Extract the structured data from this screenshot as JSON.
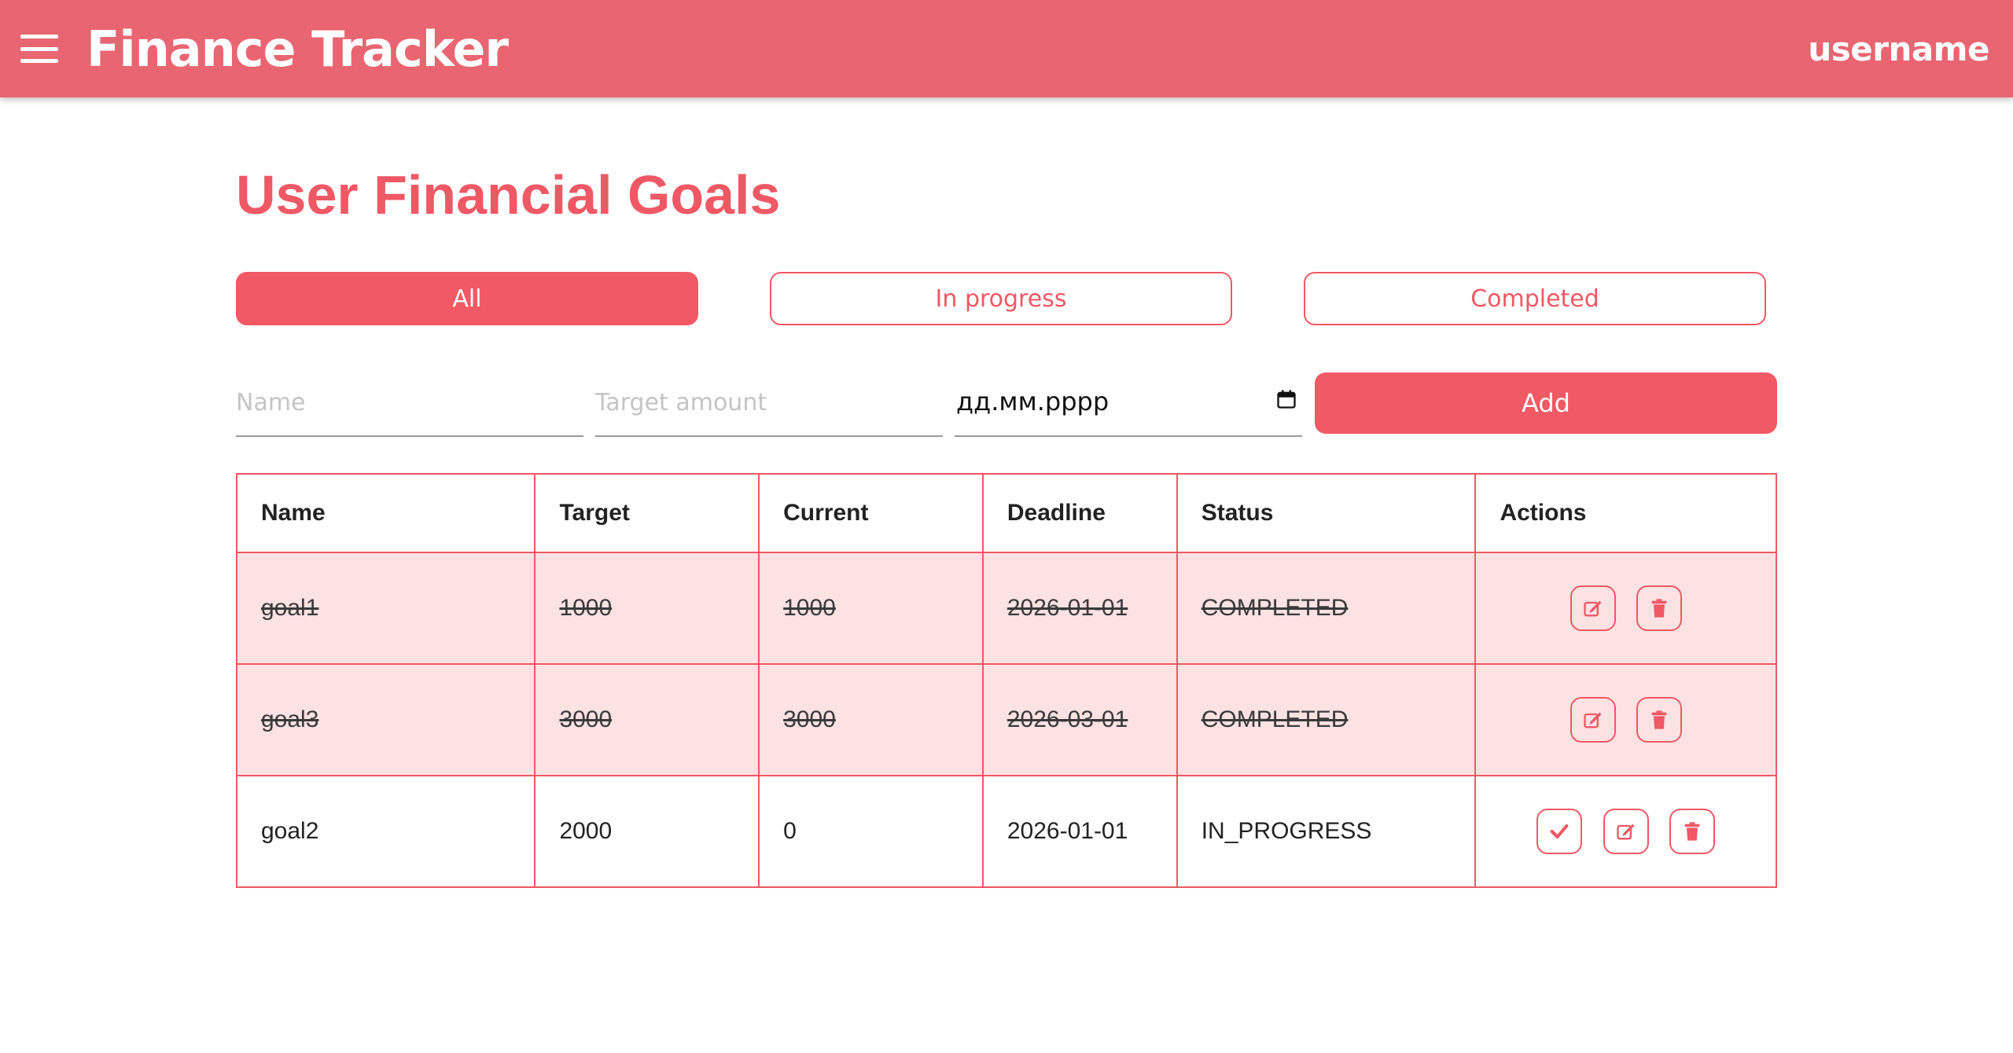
{
  "app": {
    "title": "Finance Tracker",
    "username": "username"
  },
  "page": {
    "title": "User Financial Goals"
  },
  "filters": {
    "all": "All",
    "in_progress": "In progress",
    "completed": "Completed",
    "active": "All"
  },
  "form": {
    "name_placeholder": "Name",
    "target_placeholder": "Target amount",
    "date_value": "дд.мм.рррр",
    "add_label": "Add"
  },
  "table": {
    "headers": {
      "name": "Name",
      "target": "Target",
      "current": "Current",
      "deadline": "Deadline",
      "status": "Status",
      "actions": "Actions"
    },
    "rows": [
      {
        "name": "goal1",
        "target": "1000",
        "current": "1000",
        "deadline": "2026-01-01",
        "status": "COMPLETED"
      },
      {
        "name": "goal3",
        "target": "3000",
        "current": "3000",
        "deadline": "2026-03-01",
        "status": "COMPLETED"
      },
      {
        "name": "goal2",
        "target": "2000",
        "current": "0",
        "deadline": "2026-01-01",
        "status": "IN_PROGRESS"
      }
    ]
  },
  "icons": {
    "menu": "menu-icon",
    "calendar": "calendar-icon",
    "complete": "check-icon",
    "edit": "edit-icon",
    "delete": "trash-icon"
  },
  "colors": {
    "appbar": "#e96571",
    "accent": "#f15964",
    "completed_row": "#fde2e3",
    "border": "#ef5864"
  }
}
